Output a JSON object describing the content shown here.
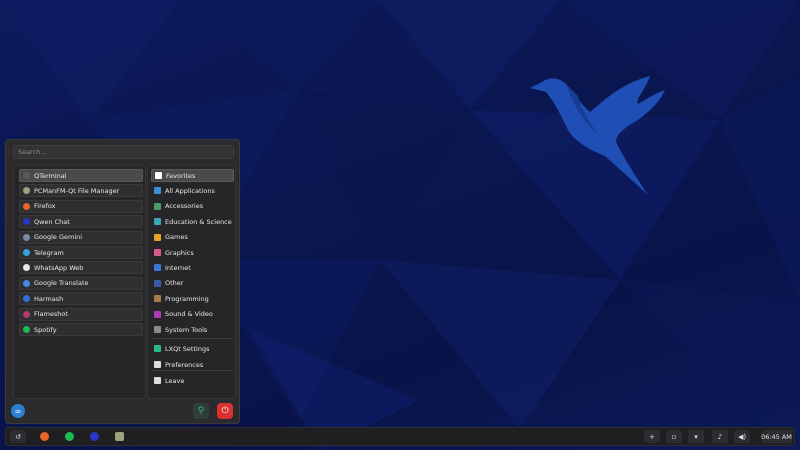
{
  "search": {
    "placeholder": "Search..."
  },
  "favorites": [
    {
      "label": "QTerminal",
      "icon": "terminal-icon",
      "color": "#5a5a5a",
      "active": true
    },
    {
      "label": "PCManFM-Qt File Manager",
      "icon": "file-manager-icon",
      "color": "#9aa37a"
    },
    {
      "label": "Firefox",
      "icon": "firefox-icon",
      "color": "#e8662a"
    },
    {
      "label": "Qwen Chat",
      "icon": "qwen-icon",
      "color": "#2936c8"
    },
    {
      "label": "Google Gemini",
      "icon": "gemini-icon",
      "color": "#7a8aa8"
    },
    {
      "label": "Telegram",
      "icon": "telegram-icon",
      "color": "#2ea3e0"
    },
    {
      "label": "WhatsApp Web",
      "icon": "whatsapp-icon",
      "color": "#e9e9e9"
    },
    {
      "label": "Google Translate",
      "icon": "translate-icon",
      "color": "#4a86e8"
    },
    {
      "label": "Harmash",
      "icon": "harmash-icon",
      "color": "#2f6fd8"
    },
    {
      "label": "Flameshot",
      "icon": "flameshot-icon",
      "color": "#b03a6e"
    },
    {
      "label": "Spotify",
      "icon": "spotify-icon",
      "color": "#1db954"
    }
  ],
  "categories": [
    {
      "label": "Favorites",
      "icon": "bookmark-icon",
      "color": "#ffffff",
      "active": true
    },
    {
      "label": "All Applications",
      "icon": "apps-icon",
      "color": "#3c8fd6"
    },
    {
      "label": "Accessories",
      "icon": "accessories-icon",
      "color": "#4a9a6a"
    },
    {
      "label": "Education & Science",
      "icon": "education-icon",
      "color": "#3aa8b8"
    },
    {
      "label": "Games",
      "icon": "games-icon",
      "color": "#e8a22a"
    },
    {
      "label": "Graphics",
      "icon": "graphics-icon",
      "color": "#d85a8a"
    },
    {
      "label": "Internet",
      "icon": "internet-icon",
      "color": "#3a78d8"
    },
    {
      "label": "Other",
      "icon": "other-icon",
      "color": "#3a5aa8"
    },
    {
      "label": "Programming",
      "icon": "programming-icon",
      "color": "#a87a4a"
    },
    {
      "label": "Sound & Video",
      "icon": "sound-video-icon",
      "color": "#b03ab0"
    },
    {
      "label": "System Tools",
      "icon": "system-tools-icon",
      "color": "#8a8a8a"
    }
  ],
  "settings": [
    {
      "label": "LXQt Settings",
      "icon": "lxqt-settings-icon",
      "color": "#2ab88a"
    },
    {
      "label": "Preferences",
      "icon": "preferences-icon",
      "color": "#dddddd"
    },
    {
      "label": "Leave",
      "icon": "leave-icon",
      "color": "#dddddd"
    }
  ],
  "menu_buttons": {
    "logo": "∞",
    "about": "⚲",
    "power": "⏻"
  },
  "taskbar": {
    "start": "↺",
    "clock": "06:45 AM",
    "tray": [
      "+",
      "▫",
      "▾",
      "♪",
      "◀)"
    ]
  },
  "colors": {
    "desktop": "#0b1650",
    "menu_bg": "#2b2b2d",
    "accent": "#2a7fd4",
    "bird": "#1e4fb8",
    "power": "#d93030"
  }
}
